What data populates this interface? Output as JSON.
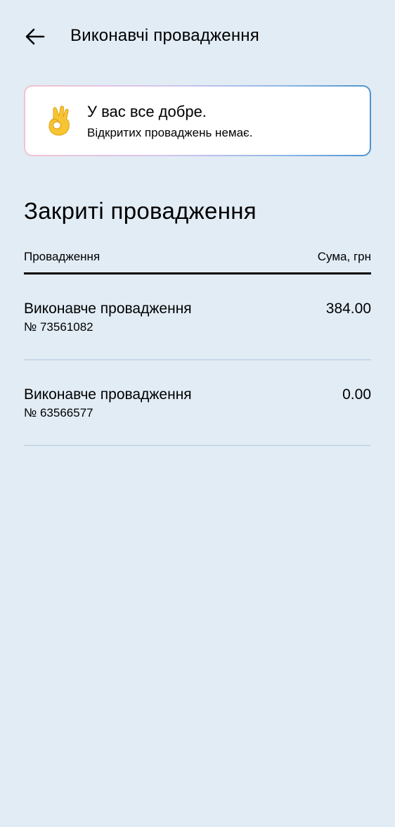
{
  "header": {
    "back_icon": "arrow-left-icon",
    "title": "Виконавчі провадження"
  },
  "status": {
    "icon": "ok-hand-icon",
    "title": "У вас все добре.",
    "subtitle": "Відкритих проваджень немає."
  },
  "closed": {
    "title": "Закриті провадження",
    "columns": {
      "left": "Провадження",
      "right": "Сума, грн"
    },
    "rows": [
      {
        "title": "Виконавче провадження",
        "number": "№ 73561082",
        "amount": "384.00"
      },
      {
        "title": "Виконавче провадження",
        "number": "№ 63566577",
        "amount": "0.00"
      }
    ]
  },
  "colors": {
    "background": "#e2ecf5",
    "card_gradient_start": "#f2c2cf",
    "card_gradient_end": "#4e92cf",
    "divider": "#c7d8e8"
  }
}
